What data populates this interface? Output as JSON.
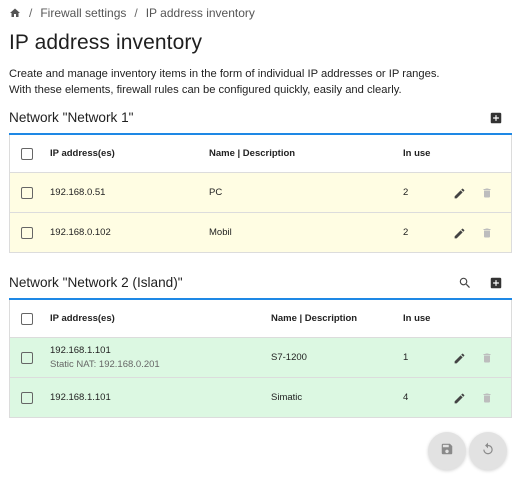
{
  "breadcrumb": {
    "home_icon": "home-icon",
    "separator": "/",
    "items": [
      "Firewall settings",
      "IP address inventory"
    ]
  },
  "page": {
    "title": "IP address inventory",
    "description_line1": "Create and manage inventory items in the form of individual IP addresses or IP ranges.",
    "description_line2": "With these elements, firewall rules can be configured quickly, easily and clearly."
  },
  "colors": {
    "accent": "#1e88e5",
    "row_yellow": "#fffde3",
    "row_green": "#dcf8e2"
  },
  "networks": [
    {
      "title": "Network \"Network 1\"",
      "actions": [
        "add-icon"
      ],
      "columns": {
        "ip": "IP address(es)",
        "name": "Name | Description",
        "in_use": "In use"
      },
      "rows": [
        {
          "ip": "192.168.0.51",
          "sub": "",
          "name": "PC",
          "in_use": "2"
        },
        {
          "ip": "192.168.0.102",
          "sub": "",
          "name": "Mobil",
          "in_use": "2"
        }
      ]
    },
    {
      "title": "Network \"Network 2 (Island)\"",
      "actions": [
        "search-icon",
        "add-icon"
      ],
      "columns": {
        "ip": "IP address(es)",
        "name": "Name | Description",
        "in_use": "In use"
      },
      "rows": [
        {
          "ip": "192.168.1.101",
          "sub": "Static NAT: 192.168.0.201",
          "name": "S7-1200",
          "in_use": "1"
        },
        {
          "ip": "192.168.1.101",
          "sub": "",
          "name": "Simatic",
          "in_use": "4"
        }
      ]
    }
  ],
  "fab": {
    "save_icon": "save-icon",
    "reset_icon": "reset-icon"
  }
}
